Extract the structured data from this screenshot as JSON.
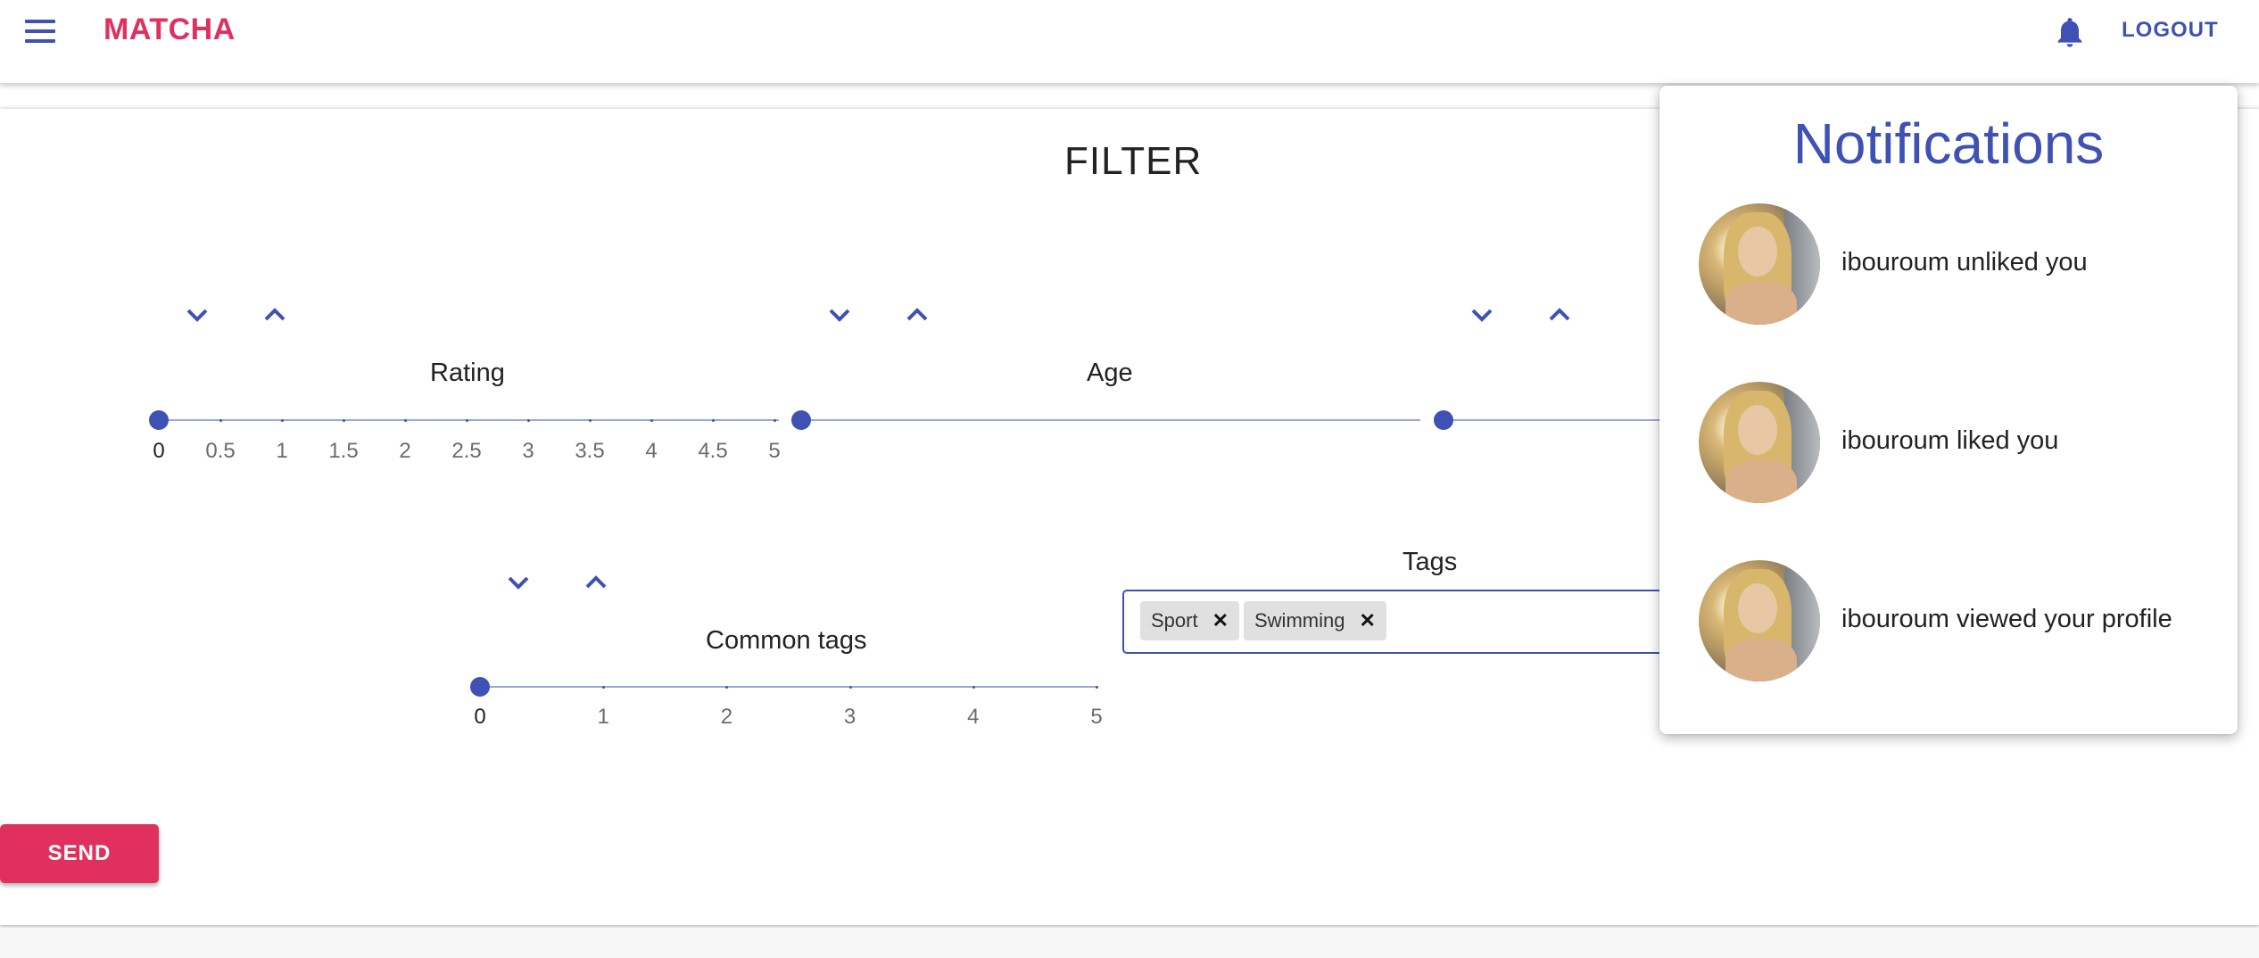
{
  "app": {
    "brand": "MATCHA",
    "logout_label": "LOGOUT"
  },
  "icons": {
    "menu": "hamburger-menu-icon",
    "notifications": "bell-icon",
    "increase": "chevron-up-icon",
    "decrease": "chevron-down-icon",
    "remove_tag": "close-icon"
  },
  "colors": {
    "primary": "#3f51b5",
    "accent": "#e0315e"
  },
  "filter": {
    "title": "FILTER",
    "rating": {
      "label": "Rating",
      "value": 0,
      "min": 0,
      "max": 5,
      "marks": [
        "0",
        "0.5",
        "1",
        "1.5",
        "2",
        "2.5",
        "3",
        "3.5",
        "4",
        "4.5",
        "5"
      ]
    },
    "age": {
      "label": "Age"
    },
    "third": {
      "label": ""
    },
    "common_tags": {
      "label": "Common tags",
      "value": 0,
      "min": 0,
      "max": 5,
      "marks": [
        "0",
        "1",
        "2",
        "3",
        "4",
        "5"
      ]
    },
    "tags": {
      "label": "Tags",
      "chips": [
        "Sport",
        "Swimming"
      ]
    },
    "send_label": "SEND"
  },
  "notifications": {
    "title": "Notifications",
    "items": [
      {
        "text": "ibouroum unliked you"
      },
      {
        "text": "ibouroum liked you"
      },
      {
        "text": "ibouroum viewed your profile"
      }
    ]
  }
}
